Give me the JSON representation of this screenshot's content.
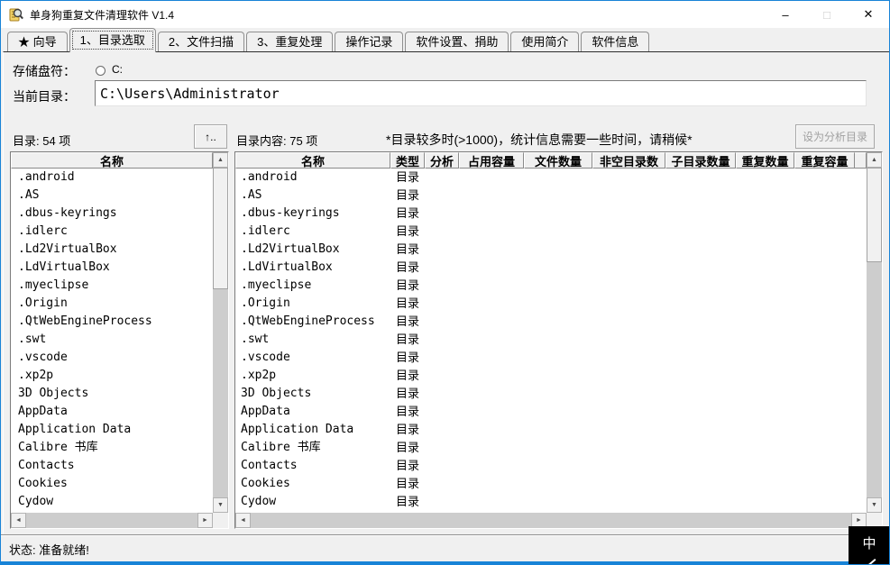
{
  "window": {
    "title": "单身狗重复文件清理软件 V1.4",
    "status_text": "状态: 准备就绪!",
    "ime_text": "中"
  },
  "icons": {
    "app_icon": "magnifier-over-document",
    "minimize_glyph": "–",
    "maximize_glyph": "□",
    "close_glyph": "✕",
    "scroll_up": "▲",
    "scroll_down": "▼",
    "scroll_left": "◄",
    "scroll_right": "►"
  },
  "colors": {
    "window_border": "#1883d7",
    "titlebar_bg": "#ffffff",
    "panel_bg": "#f0f0f0",
    "list_bg": "#ffffff",
    "disabled_text": "#a0a0a0"
  },
  "tabs": [
    {
      "label": "★ 向导",
      "selected": false
    },
    {
      "label": "1、目录选取",
      "selected": true
    },
    {
      "label": "2、文件扫描",
      "selected": false
    },
    {
      "label": "3、重复处理",
      "selected": false
    },
    {
      "label": "操作记录",
      "selected": false
    },
    {
      "label": "软件设置、捐助",
      "selected": false
    },
    {
      "label": "使用简介",
      "selected": false
    },
    {
      "label": "软件信息",
      "selected": false
    }
  ],
  "drive_selector": {
    "label": "存储盘符：",
    "options": [
      {
        "label": "C:",
        "checked": false
      }
    ]
  },
  "current_directory": {
    "label": "当前目录：",
    "value": "C:\\Users\\Administrator"
  },
  "left_panel": {
    "title": "目录: 54 项",
    "up_button_label": "↑..",
    "columns": [
      "名称"
    ],
    "items": [
      ".android",
      ".AS",
      ".dbus-keyrings",
      ".idlerc",
      ".Ld2VirtualBox",
      ".LdVirtualBox",
      ".myeclipse",
      ".Origin",
      ".QtWebEngineProcess",
      ".swt",
      ".vscode",
      ".xp2p",
      "3D Objects",
      "AppData",
      "Application Data",
      "Calibre 书库",
      "Contacts",
      "Cookies",
      "Cydow"
    ]
  },
  "right_panel": {
    "title": "目录内容: 75 项",
    "notice": "*目录较多时(>1000)，统计信息需要一些时间，请稍候*",
    "set_analysis_button": "设为分析目录",
    "columns": [
      "名称",
      "类型",
      "分析",
      "占用容量",
      "文件数量",
      "非空目录数",
      "子目录数量",
      "重复数量",
      "重复容量"
    ],
    "rows": [
      {
        "name": ".android",
        "type": "目录"
      },
      {
        "name": ".AS",
        "type": "目录"
      },
      {
        "name": ".dbus-keyrings",
        "type": "目录"
      },
      {
        "name": ".idlerc",
        "type": "目录"
      },
      {
        "name": ".Ld2VirtualBox",
        "type": "目录"
      },
      {
        "name": ".LdVirtualBox",
        "type": "目录"
      },
      {
        "name": ".myeclipse",
        "type": "目录"
      },
      {
        "name": ".Origin",
        "type": "目录"
      },
      {
        "name": ".QtWebEngineProcess",
        "type": "目录"
      },
      {
        "name": ".swt",
        "type": "目录"
      },
      {
        "name": ".vscode",
        "type": "目录"
      },
      {
        "name": ".xp2p",
        "type": "目录"
      },
      {
        "name": "3D Objects",
        "type": "目录"
      },
      {
        "name": "AppData",
        "type": "目录"
      },
      {
        "name": "Application Data",
        "type": "目录"
      },
      {
        "name": "Calibre 书库",
        "type": "目录"
      },
      {
        "name": "Contacts",
        "type": "目录"
      },
      {
        "name": "Cookies",
        "type": "目录"
      },
      {
        "name": "Cydow",
        "type": "目录"
      }
    ]
  }
}
